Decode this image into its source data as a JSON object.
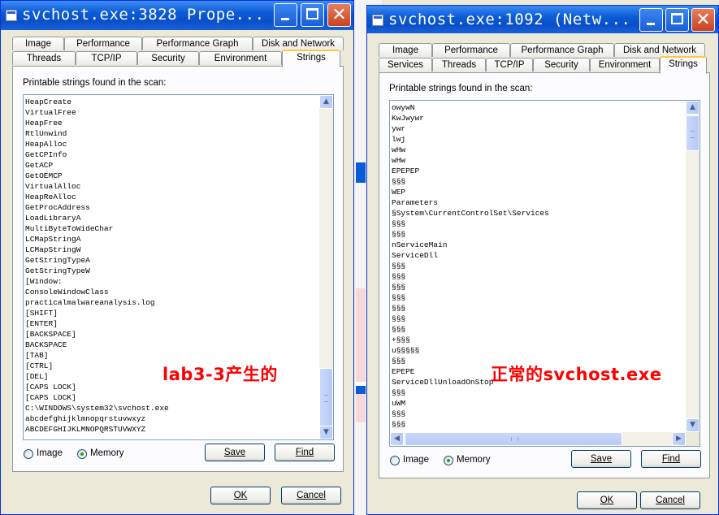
{
  "window1": {
    "title": "svchost.exe:3828 Prope...",
    "tabs_row1": [
      "Image",
      "Performance",
      "Performance Graph",
      "Disk and Network"
    ],
    "tabs_row2": [
      "Threads",
      "TCP/IP",
      "Security",
      "Environment",
      "Strings"
    ],
    "active_tab": "Strings",
    "label": "Printable strings found in the scan:",
    "strings": [
      "HeapCreate",
      "VirtualFree",
      "HeapFree",
      "RtlUnwind",
      "HeapAlloc",
      "GetCPInfo",
      "GetACP",
      "GetOEMCP",
      "VirtualAlloc",
      "HeapReAlloc",
      "GetProcAddress",
      "LoadLibraryA",
      "MultiByteToWideChar",
      "LCMapStringA",
      "LCMapStringW",
      "GetStringTypeA",
      "GetStringTypeW",
      "[Window:",
      "ConsoleWindowClass",
      "practicalmalwareanalysis.log",
      "[SHIFT]",
      "[ENTER]",
      "[BACKSPACE]",
      "BACKSPACE",
      "[TAB]",
      "[CTRL]",
      "[DEL]",
      "[CAPS LOCK]",
      "[CAPS LOCK]",
      "C:\\WINDOWS\\system32\\svchost.exe",
      "abcdefghijklmnopqrstuvwxyz",
      "ABCDEFGHIJKLMNOPQRSTUVWXYZ"
    ],
    "radio_image": "Image",
    "radio_memory": "Memory",
    "selected_radio": "Memory",
    "save_label": "Save",
    "find_label": "Find",
    "ok_label": "OK",
    "cancel_label": "Cancel",
    "annotation": "lab3-3产生的"
  },
  "window2": {
    "title": "svchost.exe:1092 (Netw...",
    "tabs_row1": [
      "Image",
      "Performance",
      "Performance Graph",
      "Disk and Network"
    ],
    "tabs_row2": [
      "Services",
      "Threads",
      "TCP/IP",
      "Security",
      "Environment",
      "Strings"
    ],
    "active_tab": "Strings",
    "label": "Printable strings found in the scan:",
    "strings": [
      "owywN",
      "KwJwywr",
      "ywr",
      "lwj",
      "wHw",
      "wHw",
      "EPEPEP",
      "§§§",
      "WEP",
      "Parameters",
      "§System\\CurrentControlSet\\Services",
      "§§§",
      "§§§",
      "nServiceMain",
      "ServiceDll",
      "§§§",
      "§§§",
      "§§§",
      "§§§",
      "§§§",
      "§§§",
      "§§§",
      "+§§§",
      "u§§§§§",
      "§§§",
      "EPEPE",
      "ServiceDllUnloadOnStop",
      "§§§",
      "uWM",
      "§§§",
      "§§§"
    ],
    "radio_image": "Image",
    "radio_memory": "Memory",
    "selected_radio": "Memory",
    "save_label": "Save",
    "find_label": "Find",
    "ok_label": "OK",
    "cancel_label": "Cancel",
    "annotation": "正常的svchost.exe"
  },
  "colors": {
    "titlebar": "#0b5bd7",
    "annotation": "#ff0000",
    "active_tab_highlight": "#ffc83c"
  }
}
